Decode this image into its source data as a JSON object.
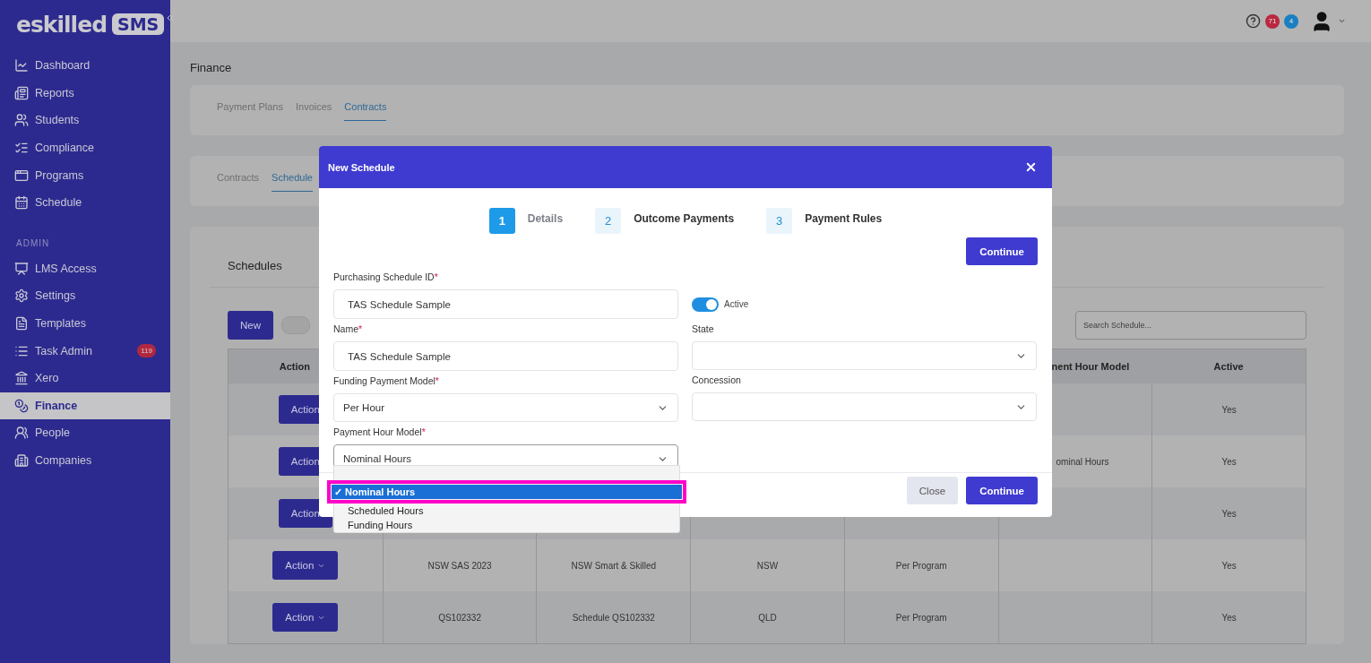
{
  "sidebar": {
    "logo": "eskilled",
    "logo_badge": "SMS",
    "sections": [
      {
        "items": [
          {
            "label": "Dashboard",
            "selected": false
          },
          {
            "label": "Reports",
            "selected": false
          },
          {
            "label": "Students",
            "selected": false
          },
          {
            "label": "Compliance",
            "selected": false
          },
          {
            "label": "Programs",
            "selected": false
          },
          {
            "label": "Schedule",
            "selected": false
          }
        ]
      },
      {
        "heading": "ADMIN",
        "items": [
          {
            "label": "LMS Access",
            "selected": false
          },
          {
            "label": "Settings",
            "selected": false
          },
          {
            "label": "Templates",
            "selected": false
          },
          {
            "label": "Task Admin",
            "selected": false,
            "badge": "119"
          },
          {
            "label": "Xero",
            "selected": false
          },
          {
            "label": "Finance",
            "selected": true
          },
          {
            "label": "People",
            "selected": false
          },
          {
            "label": "Companies",
            "selected": false
          }
        ]
      }
    ]
  },
  "topbar": {
    "alerts": "71",
    "messages": "4"
  },
  "page_title": "Finance",
  "finance_tabs": [
    {
      "label": "Payment Plans",
      "selected": false
    },
    {
      "label": "Invoices",
      "selected": false
    },
    {
      "label": "Contracts",
      "selected": true
    }
  ],
  "contract_tabs": [
    {
      "label": "Contracts",
      "selected": false
    },
    {
      "label": "Schedule",
      "selected": true
    }
  ],
  "schedules": {
    "title": "Schedules",
    "new_button": "New",
    "show_toggle": {
      "on": false
    },
    "search": {
      "placeholder": "Search Schedule..."
    },
    "columns": [
      "Action",
      null,
      null,
      null,
      null,
      "nent Hour Model",
      "Active"
    ],
    "rows": [
      {
        "cells": [
          "Action",
          null,
          null,
          null,
          null,
          null,
          "Yes"
        ]
      },
      {
        "cells": [
          "Action",
          null,
          null,
          null,
          null,
          "ominal Hours",
          "Yes"
        ]
      },
      {
        "cells": [
          "Action",
          null,
          null,
          null,
          null,
          null,
          "Yes"
        ]
      },
      {
        "cells": [
          "Action",
          "NSW SAS 2023",
          "NSW Smart & Skilled",
          "NSW",
          "Per Program",
          null,
          "Yes"
        ]
      },
      {
        "cells": [
          "Action",
          "QS102332",
          "Schedule QS102332",
          "QLD",
          "Per Program",
          null,
          "Yes"
        ]
      }
    ]
  },
  "modal": {
    "title": "New Schedule",
    "steps": [
      {
        "number": "1",
        "label": "Details",
        "selected": true
      },
      {
        "number": "2",
        "label": "Outcome Payments",
        "selected": false
      },
      {
        "number": "3",
        "label": "Payment Rules",
        "selected": false
      }
    ],
    "continue_top": "Continue",
    "left_fields": [
      {
        "label": "Purchasing Schedule ID",
        "mark": "*",
        "kind": "text",
        "value": "TAS Schedule Sample"
      },
      {
        "label": "Name",
        "mark": "*",
        "kind": "text",
        "value": "TAS Schedule Sample"
      },
      {
        "label": "Funding Payment Model",
        "mark": "*",
        "kind": "select",
        "value": "Per Hour",
        "focused": false
      },
      {
        "label": "Payment Hour Model",
        "mark": "*",
        "kind": "select",
        "value": "Nominal Hours",
        "focused": true
      }
    ],
    "active_toggle": {
      "label": "Active",
      "on": true
    },
    "right_fields": [
      {
        "label": "State",
        "kind": "select",
        "focused": false
      },
      {
        "label": "Concession",
        "kind": "select",
        "focused": false
      }
    ],
    "dropdown": {
      "check": "✓",
      "options": [
        {
          "selected": false
        },
        {
          "label": "Nominal Hours",
          "selected": true,
          "annotated": true
        },
        {
          "label": "Scheduled Hours",
          "selected": false
        },
        {
          "label": "Funding Hours",
          "selected": false
        }
      ]
    },
    "footer": {
      "close": "Close",
      "continue": "Continue"
    }
  }
}
